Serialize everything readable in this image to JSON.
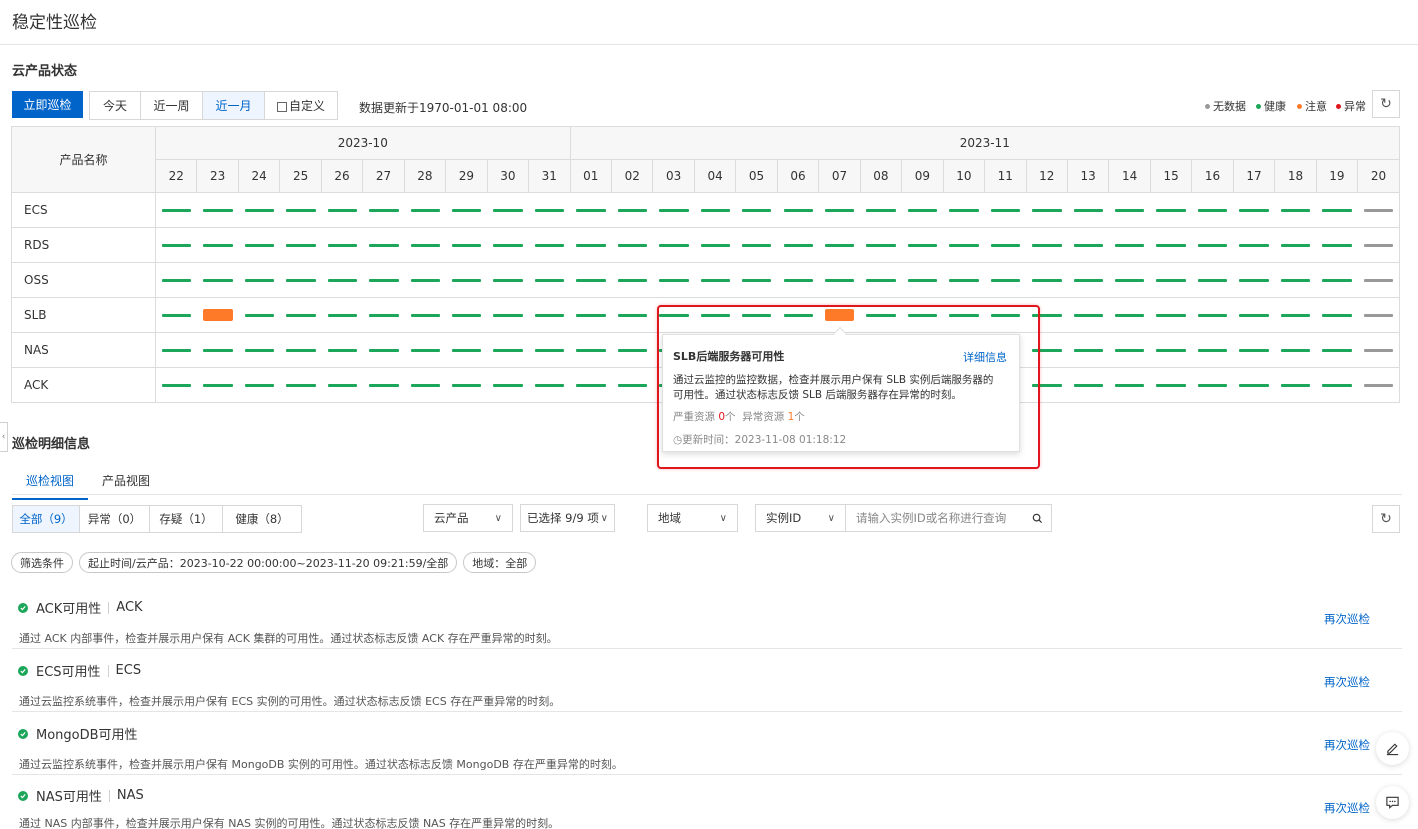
{
  "page_title": "稳定性巡检",
  "status_section": {
    "title": "云产品状态",
    "inspect_button": "立即巡检",
    "time_tabs": [
      "今天",
      "近一周",
      "近一月",
      "自定义"
    ],
    "active_tab": "近一月",
    "updated_text": "数据更新于1970-01-01 08:00",
    "legend": [
      {
        "label": "无数据",
        "color": "#999999"
      },
      {
        "label": "健康",
        "color": "#1ca65a"
      },
      {
        "label": "注意",
        "color": "#ff7a28"
      },
      {
        "label": "异常",
        "color": "#e0161d"
      }
    ]
  },
  "grid": {
    "name_header": "产品名称",
    "months": [
      {
        "label": "2023-10",
        "days": [
          "22",
          "23",
          "24",
          "25",
          "26",
          "27",
          "28",
          "29",
          "30",
          "31"
        ]
      },
      {
        "label": "2023-11",
        "days": [
          "01",
          "02",
          "03",
          "04",
          "05",
          "06",
          "07",
          "08",
          "09",
          "10",
          "11",
          "12",
          "13",
          "14",
          "15",
          "16",
          "17",
          "18",
          "19",
          "20"
        ]
      }
    ],
    "colors": {
      "h": "#1ca65a",
      "w": "#ff7a28",
      "n": "#999999"
    },
    "rows": [
      {
        "name": "ECS",
        "status": "hhhhhhhhhhhhhhhhhhhhhhhhhhhhhn"
      },
      {
        "name": "RDS",
        "status": "hhhhhhhhhhhhhhhhhhhhhhhhhhhhhn"
      },
      {
        "name": "OSS",
        "status": "hhhhhhhhhhhhhhhhhhhhhhhhhhhhhn"
      },
      {
        "name": "SLB",
        "status": "hwhhhhhhhhhhhhhhwhhhhhhhhhhhhn"
      },
      {
        "name": "NAS",
        "status": "hhhhhhhhhhhhhhhhhhhhhhhhhhhhhn"
      },
      {
        "name": "ACK",
        "status": "hhhhhhhhhhhhhhhhhhhhhhhhhhhhhn"
      }
    ]
  },
  "tooltip": {
    "title": "SLB后端服务器可用性",
    "link": "详细信息",
    "desc_line1": "通过云监控的监控数据，检查并展示用户保有 SLB 实例后端服务器的",
    "desc_line2": "可用性。通过状态标志反馈 SLB 后端服务器存在异常的时刻。",
    "severe_label": "严重资源",
    "severe_count": "0",
    "severe_unit": "个",
    "abnormal_label": "异常资源",
    "abnormal_count": "1",
    "abnormal_unit": "个",
    "update_time": "更新时间：2023-11-08 01:18:12"
  },
  "detail_section": {
    "title": "巡检明细信息",
    "view_tabs": [
      "巡检视图",
      "产品视图"
    ],
    "status_filters": [
      "全部（9）",
      "异常（0）",
      "存疑（1）",
      "健康（8）"
    ],
    "product_select": "云产品",
    "selected_select": "已选择 9/9 项",
    "region_select": "地域",
    "instance_select": "实例ID",
    "search_placeholder": "请输入实例ID或名称进行查询",
    "chips": [
      "筛选条件",
      "起止时间/云产品：2023-10-22 00:00:00~2023-11-20 09:21:59/全部",
      "地域：全部"
    ],
    "recheck_label": "再次巡检",
    "items": [
      {
        "name": "ACK可用性",
        "product": "ACK",
        "desc": "通过 ACK 内部事件，检查并展示用户保有 ACK 集群的可用性。通过状态标志反馈 ACK 存在严重异常的时刻。"
      },
      {
        "name": "ECS可用性",
        "product": "ECS",
        "desc": "通过云监控系统事件，检查并展示用户保有 ECS 实例的可用性。通过状态标志反馈 ECS 存在严重异常的时刻。"
      },
      {
        "name": "MongoDB可用性",
        "product": "",
        "desc": "通过云监控系统事件，检查并展示用户保有 MongoDB 实例的可用性。通过状态标志反馈 MongoDB 存在严重异常的时刻。"
      },
      {
        "name": "NAS可用性",
        "product": "NAS",
        "desc": "通过 NAS 内部事件，检查并展示用户保有 NAS 实例的可用性。通过状态标志反馈 NAS 存在严重异常的时刻。"
      }
    ]
  }
}
